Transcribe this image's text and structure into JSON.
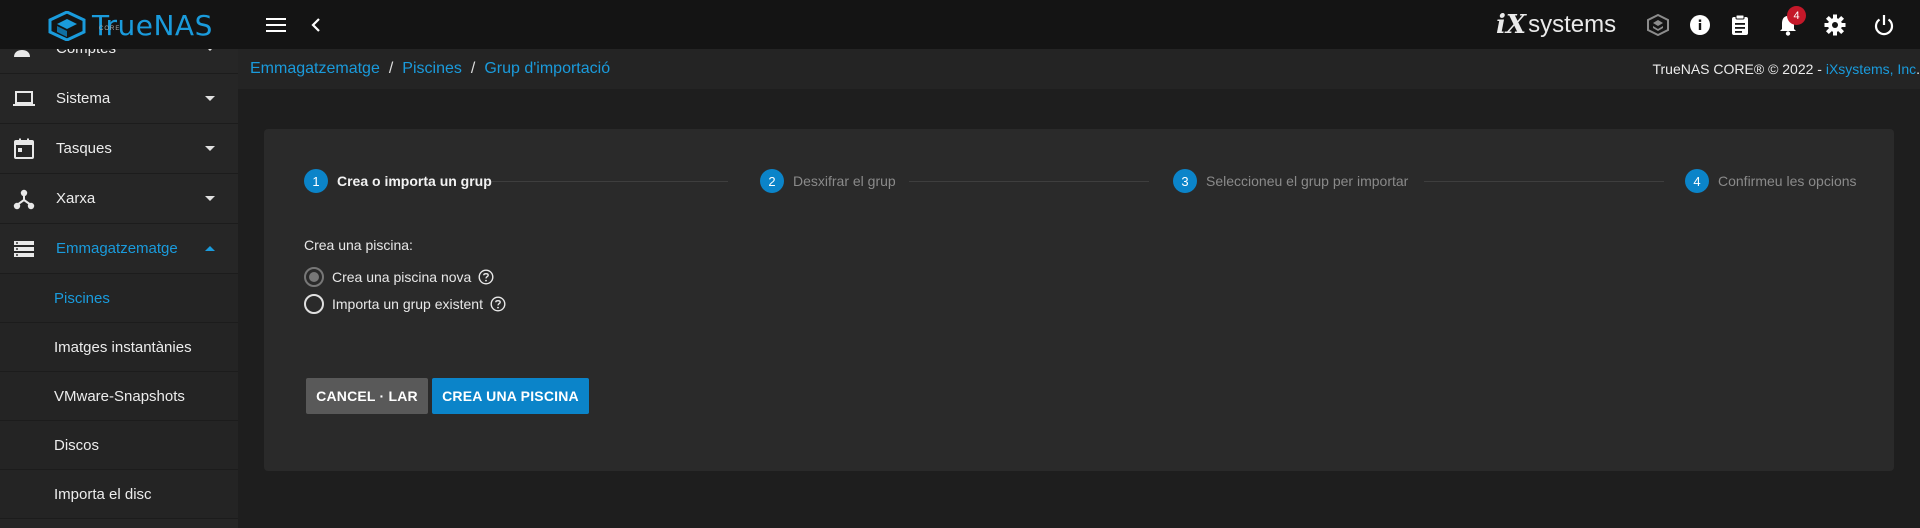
{
  "brand": {
    "name": "TrueNAS",
    "edition": "CORE",
    "vendor_i": "iX",
    "vendor_rest": "systems"
  },
  "notifications": {
    "count": "4"
  },
  "sidebar": {
    "items": [
      {
        "label": "Comptes",
        "icon": "accounts-icon",
        "expanded": false
      },
      {
        "label": "Sistema",
        "icon": "laptop-icon",
        "expanded": false
      },
      {
        "label": "Tasques",
        "icon": "calendar-icon",
        "expanded": false
      },
      {
        "label": "Xarxa",
        "icon": "network-icon",
        "expanded": false
      },
      {
        "label": "Emmagatzematge",
        "icon": "storage-icon",
        "expanded": true
      }
    ],
    "subitems": [
      {
        "label": "Piscines",
        "active": true
      },
      {
        "label": "Imatges instantànies",
        "active": false
      },
      {
        "label": "VMware-Snapshots",
        "active": false
      },
      {
        "label": "Discos",
        "active": false
      },
      {
        "label": "Importa el disc",
        "active": false
      }
    ]
  },
  "breadcrumb": [
    "Emmagatzematge",
    "Piscines",
    "Grup d'importació"
  ],
  "copyright": {
    "text": "TrueNAS CORE® © 2022 - ",
    "link": "iXsystems, Inc",
    "suffix": "."
  },
  "wizard": {
    "steps": [
      {
        "num": "1",
        "label": "Crea o importa un grup",
        "active": true
      },
      {
        "num": "2",
        "label": "Desxifrar el grup",
        "active": false
      },
      {
        "num": "3",
        "label": "Seleccioneu el grup per importar",
        "active": false
      },
      {
        "num": "4",
        "label": "Confirmeu les opcions",
        "active": false
      }
    ],
    "form_title": "Crea una piscina:",
    "options": [
      {
        "label": "Crea una piscina nova",
        "checked": true
      },
      {
        "label": "Importa un grup existent",
        "checked": false
      }
    ],
    "cancel_label": "CANCEL · LAR",
    "create_label": "CREA UNA PISCINA"
  },
  "colors": {
    "accent": "#1a9bdc",
    "step_circle": "#0b84c9",
    "badge": "#c41829",
    "topbar": "#141414",
    "sidebar": "#262626",
    "card": "#2a2a2a"
  }
}
